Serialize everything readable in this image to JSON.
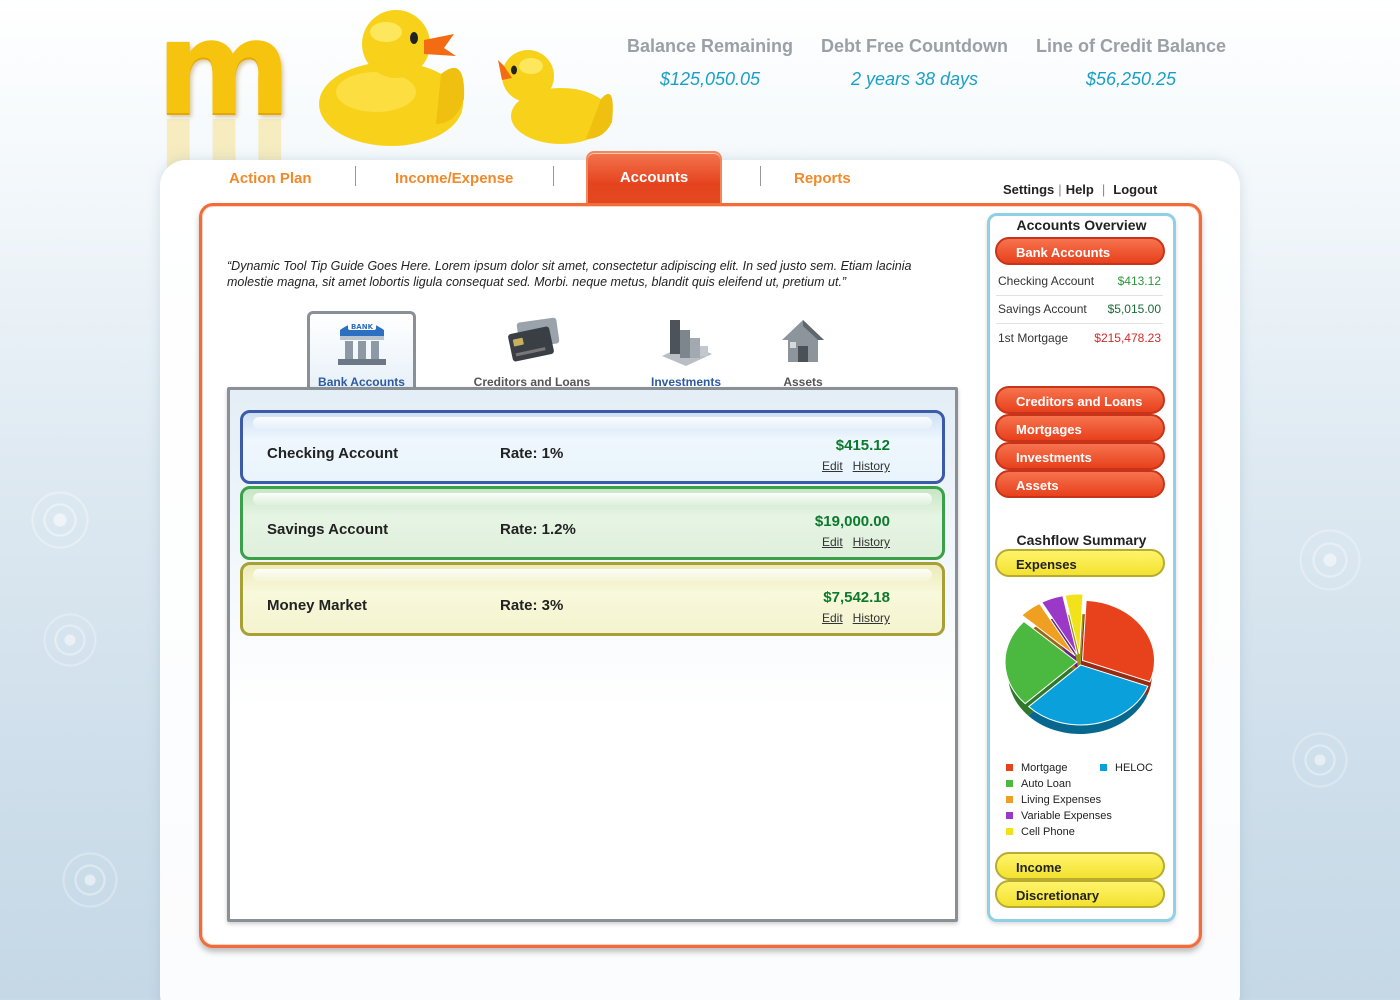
{
  "header": {
    "stats": [
      {
        "label": "Balance Remaining",
        "value": "$125,050.05"
      },
      {
        "label": "Debt Free Countdown",
        "value": "2 years 38 days"
      },
      {
        "label": "Line of Credit Balance",
        "value": "$56,250.25"
      }
    ]
  },
  "nav": {
    "tabs": [
      {
        "label": "Action Plan"
      },
      {
        "label": "Income/Expense"
      },
      {
        "label": "Accounts",
        "active": true
      },
      {
        "label": "Reports"
      }
    ],
    "links": {
      "settings": "Settings",
      "help": "Help",
      "logout": "Logout"
    }
  },
  "tip": "“Dynamic Tool Tip Guide Goes Here. Lorem ipsum dolor sit amet, consectetur adipiscing elit. In sed justo sem. Etiam lacinia molestie magna, sit amet lobortis ligula consequat sed. Morbi. neque metus, blandit quis eleifend ut, pretium ut.”",
  "categories": [
    {
      "label": "Bank Accounts",
      "icon": "bank-icon",
      "active": true
    },
    {
      "label": "Creditors and Loans",
      "icon": "credit-card-icon"
    },
    {
      "label": "Investments",
      "icon": "investments-icon"
    },
    {
      "label": "Assets",
      "icon": "house-icon"
    }
  ],
  "accounts": [
    {
      "name": "Checking Account",
      "rate": "Rate: 1%",
      "amount": "$415.12",
      "edit": "Edit",
      "history": "History"
    },
    {
      "name": "Savings Account",
      "rate": "Rate: 1.2%",
      "amount": "$19,000.00",
      "edit": "Edit",
      "history": "History"
    },
    {
      "name": "Money Market",
      "rate": "Rate: 3%",
      "amount": "$7,542.18",
      "edit": "Edit",
      "history": "History"
    }
  ],
  "sidebar": {
    "overview_title": "Accounts Overview",
    "bank_accounts": "Bank Accounts",
    "summary": [
      {
        "label": "Checking Account",
        "value": "$413.12",
        "color": "#2a9a3a"
      },
      {
        "label": "Savings Account",
        "value": "$5,015.00",
        "color": "#1b6a3a"
      },
      {
        "label": "1st Mortgage",
        "value": "$215,478.23",
        "color": "#d42a2a"
      }
    ],
    "sections": [
      "Creditors and Loans",
      "Mortgages",
      "Investments",
      "Assets"
    ],
    "cashflow_title": "Cashflow Summary",
    "expenses": "Expenses",
    "income": "Income",
    "discretionary": "Discretionary"
  },
  "colors": {
    "accent": "#f26b3a",
    "nav_text": "#f08a2a",
    "stat_value": "#1aa0c8",
    "money_green": "#0c7a2c"
  },
  "chart_data": {
    "type": "pie",
    "title": "",
    "legend_position": "bottom",
    "series": [
      {
        "name": "Mortgage",
        "value": 30,
        "color": "#e8421c"
      },
      {
        "name": "HELOC",
        "value": 32,
        "color": "#0aa0dc"
      },
      {
        "name": "Auto Loan",
        "value": 24,
        "color": "#4bb840"
      },
      {
        "name": "Living Expenses",
        "value": 5,
        "color": "#f0a020"
      },
      {
        "name": "Variable Expenses",
        "value": 5,
        "color": "#9a38c8"
      },
      {
        "name": "Cell Phone",
        "value": 4,
        "color": "#f2e21a"
      }
    ]
  }
}
